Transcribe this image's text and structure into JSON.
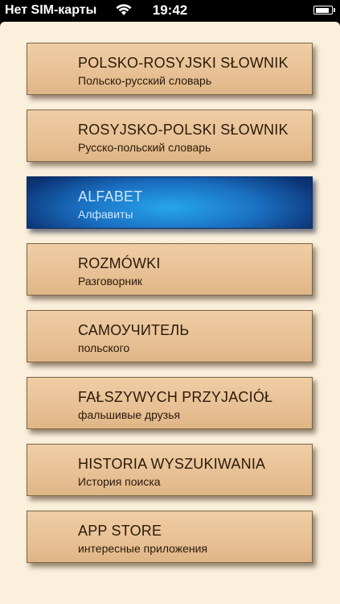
{
  "status_bar": {
    "carrier": "Нет SIM-карты",
    "time": "19:42",
    "wifi_icon": "wifi-icon",
    "battery_icon": "battery-icon",
    "battery_level": 0.9
  },
  "colors": {
    "background": "#fbf0dc",
    "button": "#e8c196",
    "button_active": "#1a6fc0",
    "text": "#2a1a0a"
  },
  "menu": {
    "items": [
      {
        "title": "POLSKO-ROSYJSKI SŁOWNIK",
        "subtitle": "Польско-русский словарь",
        "active": false
      },
      {
        "title": "ROSYJSKO-POLSKI SŁOWNIK",
        "subtitle": "Русско-польский словарь",
        "active": false
      },
      {
        "title": "ALFABET",
        "subtitle": "Алфавиты",
        "active": true
      },
      {
        "title": "ROZMÓWKI",
        "subtitle": "Разговорник",
        "active": false
      },
      {
        "title": "САМОУЧИТЕЛЬ",
        "subtitle": "польского",
        "active": false
      },
      {
        "title": "FAŁSZYWYCH PRZYJACIÓŁ",
        "subtitle": "фальшивые друзья",
        "active": false
      },
      {
        "title": "HISTORIA WYSZUKIWANIA",
        "subtitle": "История поиска",
        "active": false
      },
      {
        "title": "APP STORE",
        "subtitle": "интересные приложения",
        "active": false
      }
    ]
  }
}
